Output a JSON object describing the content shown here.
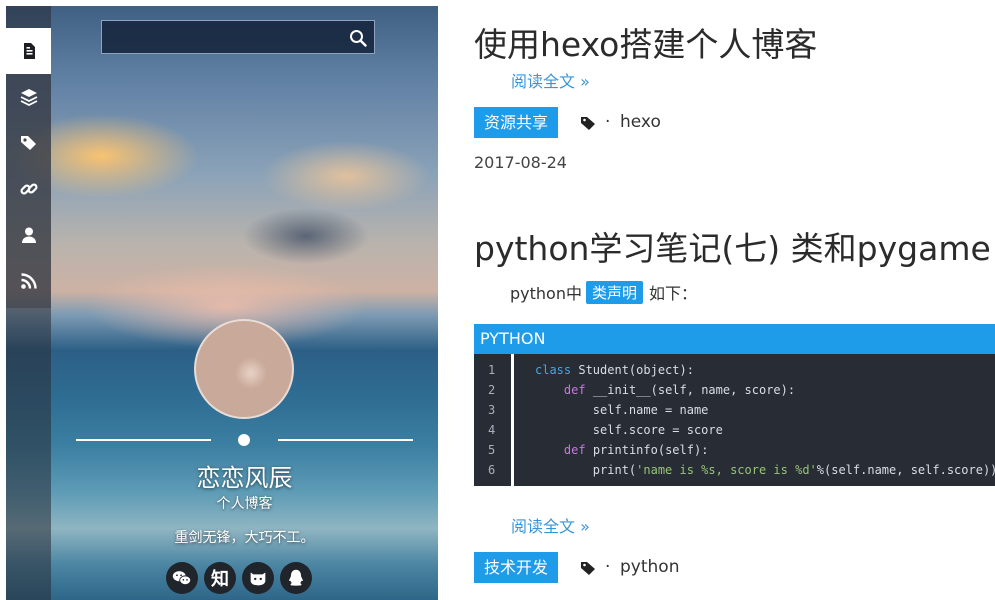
{
  "sidebar": {
    "nav_icons": [
      "document-icon",
      "layers-icon",
      "tags-icon",
      "link-icon",
      "user-icon",
      "rss-icon"
    ],
    "search": {
      "placeholder": ""
    },
    "author": {
      "name": "恋恋风辰",
      "subtitle": "个人博客",
      "motto": "重剑无锋，大巧不工。"
    },
    "social": [
      {
        "icon": "wechat-icon"
      },
      {
        "icon": "zhihu-icon",
        "text": "知"
      },
      {
        "icon": "github-icon"
      },
      {
        "icon": "qq-icon"
      }
    ]
  },
  "posts": [
    {
      "title": "使用hexo搭建个人博客",
      "read_more": "阅读全文 »",
      "category": "资源共享",
      "tag_separator": "·",
      "tag": "hexo",
      "date": "2017-08-24"
    },
    {
      "title": "python学习笔记(七) 类和pygame",
      "excerpt_before": "python中",
      "excerpt_code": "类声明",
      "excerpt_after": "如下：",
      "code_language": "PYTHON",
      "code_line_numbers": [
        "1",
        "2",
        "3",
        "4",
        "5",
        "6"
      ],
      "read_more": "阅读全文 »",
      "category": "技术开发",
      "tag_separator": "·",
      "tag": "python"
    }
  ],
  "colors": {
    "accent": "#1e9be9",
    "link": "#3a95d8",
    "code_bg": "#282c34"
  }
}
